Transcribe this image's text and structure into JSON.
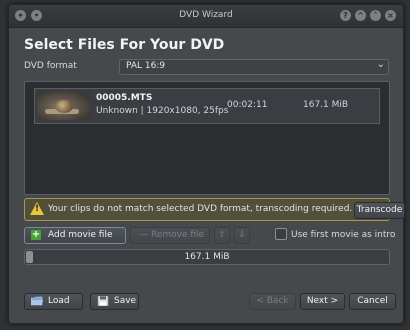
{
  "window": {
    "title": "DVD Wizard",
    "titlebar_left_glyphs": [
      "✦",
      "•"
    ],
    "titlebar_right_glyphs": [
      "?",
      "^",
      "˄",
      "×"
    ]
  },
  "heading": "Select Files For Your DVD",
  "format": {
    "label": "DVD format",
    "value": "PAL 16:9"
  },
  "clips": [
    {
      "filename": "00005.MTS",
      "info": "Unknown | 1920x1080, 25fps",
      "duration": "00:02:11",
      "size": "167.1 MiB"
    }
  ],
  "warning": {
    "message": "Your clips do not match selected DVD format, transcoding required.",
    "button": "Transcode"
  },
  "actions": {
    "add": "Add movie file",
    "remove": "Remove file",
    "up_glyph": "⇧",
    "down_glyph": "⇩",
    "intro_label": "Use first movie as intro",
    "intro_checked": false
  },
  "progress": {
    "text": "167.1 MiB",
    "fraction": 0.02
  },
  "footer": {
    "load": "Load",
    "save": "Save",
    "back": "< Back",
    "next": "Next >",
    "cancel": "Cancel"
  }
}
